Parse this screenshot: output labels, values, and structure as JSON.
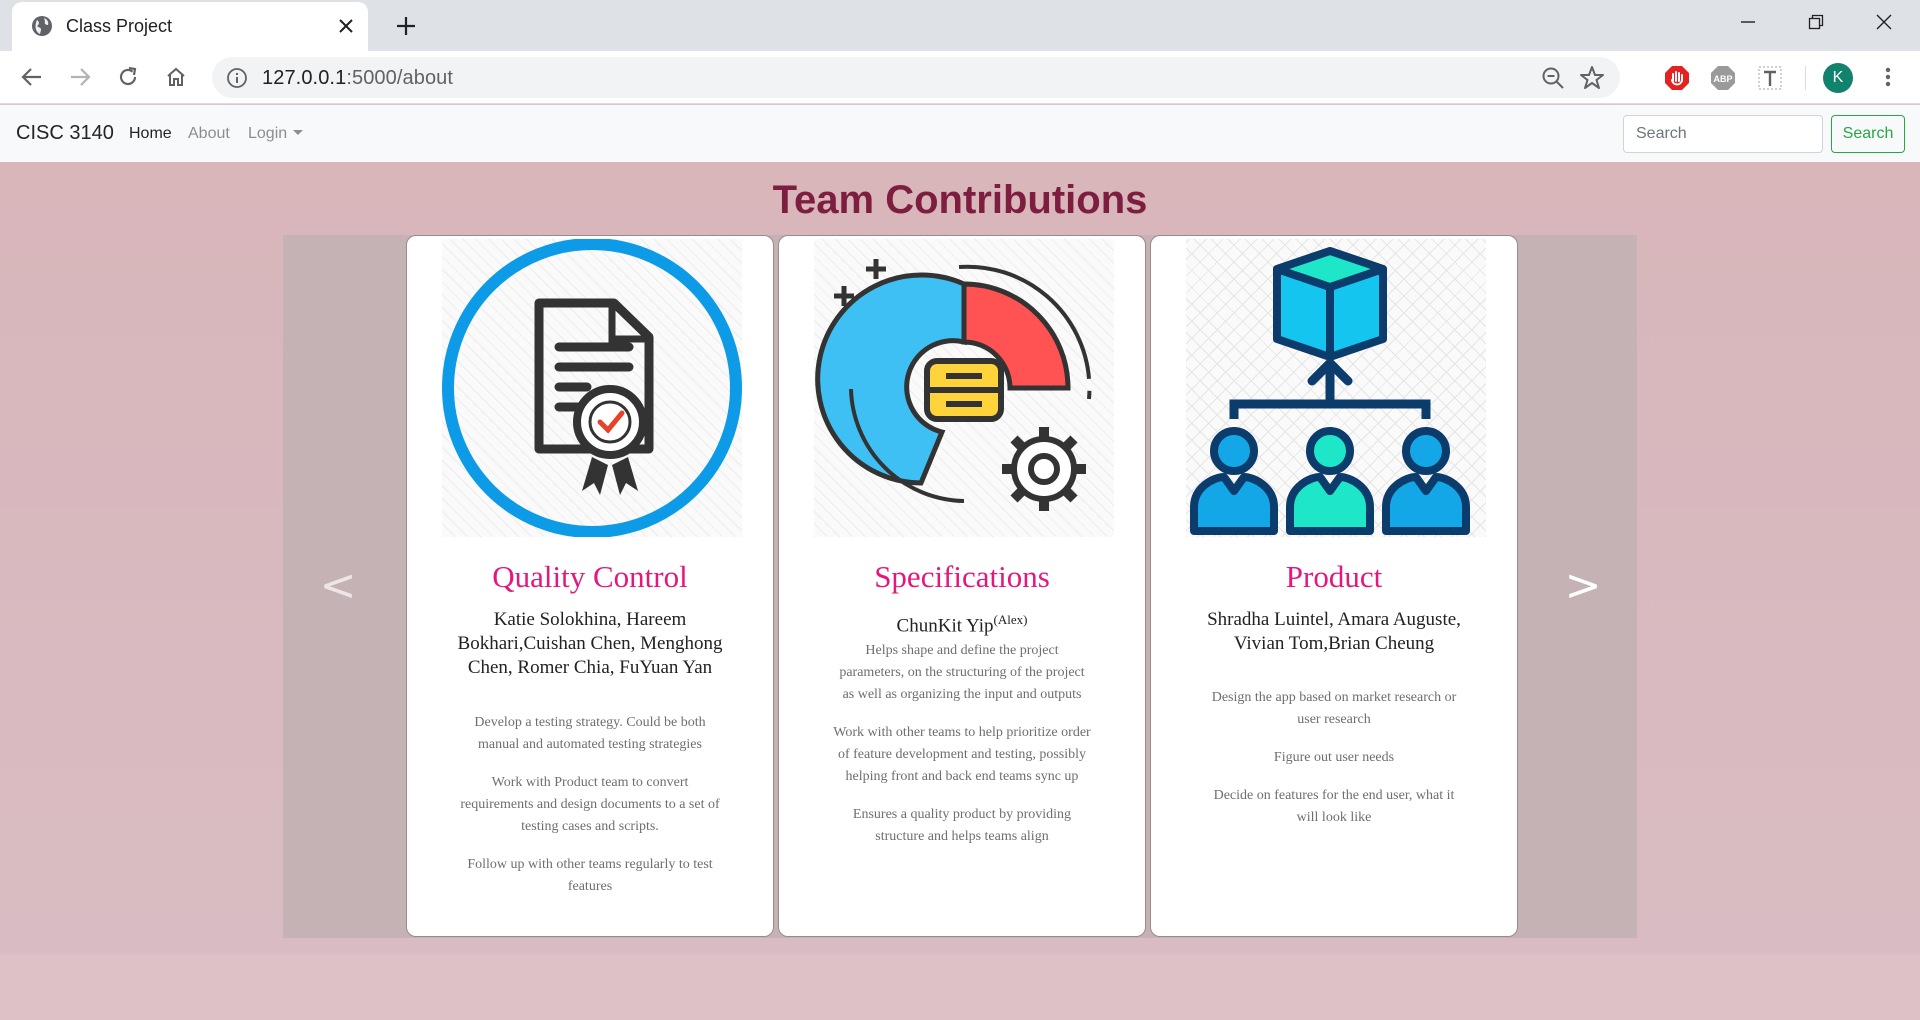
{
  "browser": {
    "tab_title": "Class Project",
    "url_host": "127.0.0.1",
    "url_path": ":5000/about",
    "profile_initial": "K"
  },
  "navbar": {
    "brand": "CISC 3140",
    "links": [
      "Home",
      "About",
      "Login"
    ],
    "search_placeholder": "Search",
    "search_button": "Search"
  },
  "page": {
    "title": "Team Contributions"
  },
  "carousel": {
    "prev_symbol": "<",
    "next_symbol": ">",
    "cards": [
      {
        "icon": "certificate-icon",
        "title": "Quality Control",
        "names": "Katie Solokhina, Hareem Bokhari,Cuishan Chen, Menghong Chen, Romer Chia, FuYuan Yan",
        "names_sup": "",
        "paragraphs": [
          "Develop a testing strategy. Could be both manual and automated testing strategies",
          "Work with Product team to convert requirements and design documents to a set of testing cases and scripts.",
          "Follow up with other teams regularly to test features"
        ]
      },
      {
        "icon": "analytics-gear-icon",
        "title": "Specifications",
        "names": "ChunKit Yip",
        "names_sup": "(Alex)",
        "paragraphs": [
          "Helps shape and define the project parameters, on the structuring of the project as well as organizing the input and outputs",
          "Work with other teams to help prioritize order of feature development and testing, possibly helping front and back end teams sync up",
          "Ensures a quality product by providing structure and helps teams align"
        ]
      },
      {
        "icon": "team-hierarchy-icon",
        "title": "Product",
        "names": "Shradha Luintel, Amara Auguste, Vivian Tom,Brian Cheung",
        "names_sup": "",
        "paragraphs": [
          "Design the app based on market research or user research",
          "Figure out user needs",
          "Decide on features for the end user, what it will look like"
        ]
      }
    ]
  },
  "colors": {
    "title": "#7d1e41",
    "card_title": "#e5177c",
    "accent_blue": "#1e9bd7",
    "search_green": "#28a745"
  }
}
